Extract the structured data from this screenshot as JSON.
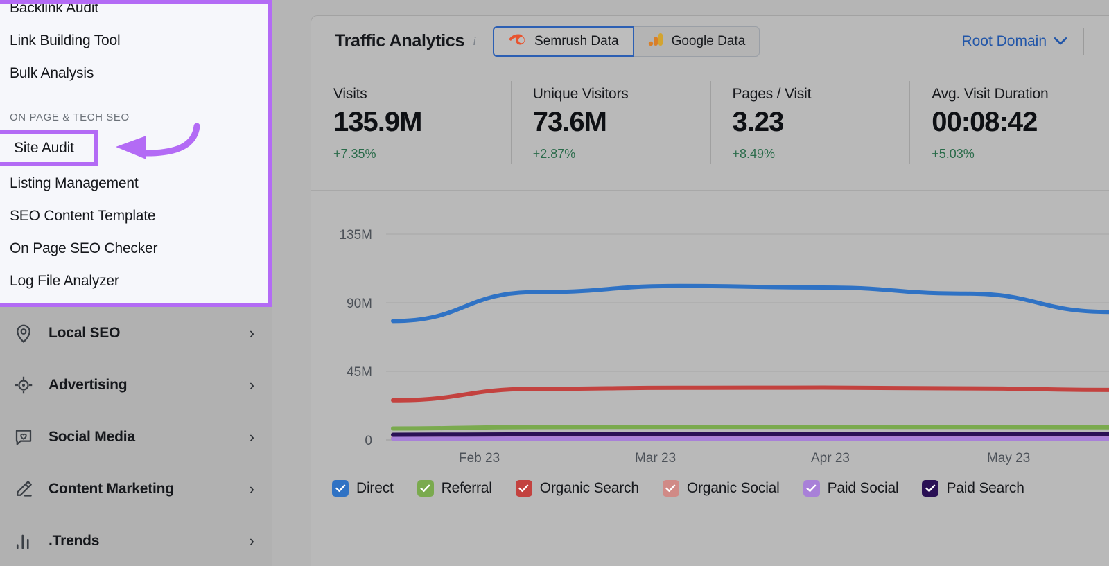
{
  "colors": {
    "annotation": "#b36bf5",
    "link": "#2256a8",
    "positive": "#2a6b4a",
    "sidebar_bg": "#b1b1b1",
    "flyout_bg": "#f6f7fb",
    "panel_bg": "#b9b9b9"
  },
  "sidebar": {
    "flyout": {
      "items_top": [
        {
          "label": "Backlink Audit"
        },
        {
          "label": "Link Building Tool"
        },
        {
          "label": "Bulk Analysis"
        }
      ],
      "section_heading": "ON PAGE & TECH SEO",
      "highlighted_item": "Site Audit",
      "items_bottom": [
        {
          "label": "Listing Management"
        },
        {
          "label": "SEO Content Template"
        },
        {
          "label": "On Page SEO Checker"
        },
        {
          "label": "Log File Analyzer"
        }
      ]
    },
    "groups": [
      {
        "label": "Local SEO",
        "icon": "map-pin-icon",
        "chevron": "›"
      },
      {
        "label": "Advertising",
        "icon": "target-icon",
        "chevron": "›"
      },
      {
        "label": "Social Media",
        "icon": "chat-heart-icon",
        "chevron": "›"
      },
      {
        "label": "Content Marketing",
        "icon": "pencil-icon",
        "chevron": "›"
      },
      {
        "label": ".Trends",
        "icon": "bar-chart-icon",
        "chevron": "›"
      }
    ]
  },
  "header": {
    "title": "Traffic Analytics",
    "info_glyph": "i",
    "tabs": [
      {
        "label": "Semrush Data",
        "icon": "semrush-logo-icon",
        "active": true
      },
      {
        "label": "Google Data",
        "icon": "google-analytics-icon",
        "active": false
      }
    ],
    "scope_selector": {
      "label": "Root Domain",
      "chevron": "⌄"
    }
  },
  "metrics": [
    {
      "label": "Visits",
      "value": "135.9M",
      "delta": "+7.35%"
    },
    {
      "label": "Unique Visitors",
      "value": "73.6M",
      "delta": "+2.87%"
    },
    {
      "label": "Pages / Visit",
      "value": "3.23",
      "delta": "+8.49%"
    },
    {
      "label": "Avg. Visit Duration",
      "value": "00:08:42",
      "delta": "+5.03%"
    }
  ],
  "chart_data": {
    "type": "line",
    "title": "",
    "xlabel": "",
    "ylabel": "",
    "x": [
      "Feb 23",
      "Mar 23",
      "Apr 23",
      "May 23"
    ],
    "xticks": [
      "Feb 23",
      "Mar 23",
      "Apr 23",
      "May 23"
    ],
    "yticks": [
      "0",
      "45M",
      "90M",
      "135M"
    ],
    "ytick_values": [
      0,
      45000000,
      90000000,
      135000000
    ],
    "ylim": [
      0,
      150000000
    ],
    "grid": true,
    "legend_position": "bottom",
    "series": [
      {
        "name": "Direct",
        "color": "#2f72c4",
        "checked": true,
        "values": [
          78000000,
          97000000,
          101000000,
          100000000,
          96000000,
          84000000
        ]
      },
      {
        "name": "Referral",
        "color": "#7aaa4e",
        "checked": true,
        "values": [
          7500000,
          8400000,
          8600000,
          8600000,
          8500000,
          8300000
        ]
      },
      {
        "name": "Organic Search",
        "color": "#c3423f",
        "checked": true,
        "values": [
          26000000,
          33500000,
          34200000,
          34300000,
          33800000,
          32800000
        ]
      },
      {
        "name": "Organic Social",
        "color": "#d08a86",
        "checked": true,
        "values": [
          1200000,
          1300000,
          1300000,
          1300000,
          1300000,
          1300000
        ]
      },
      {
        "name": "Paid Social",
        "color": "#a880d8",
        "checked": true,
        "values": [
          800000,
          850000,
          870000,
          870000,
          860000,
          850000
        ]
      },
      {
        "name": "Paid Search",
        "color": "#2a1055",
        "checked": true,
        "values": [
          3400000,
          3700000,
          3800000,
          3800000,
          3750000,
          3700000
        ]
      }
    ]
  }
}
